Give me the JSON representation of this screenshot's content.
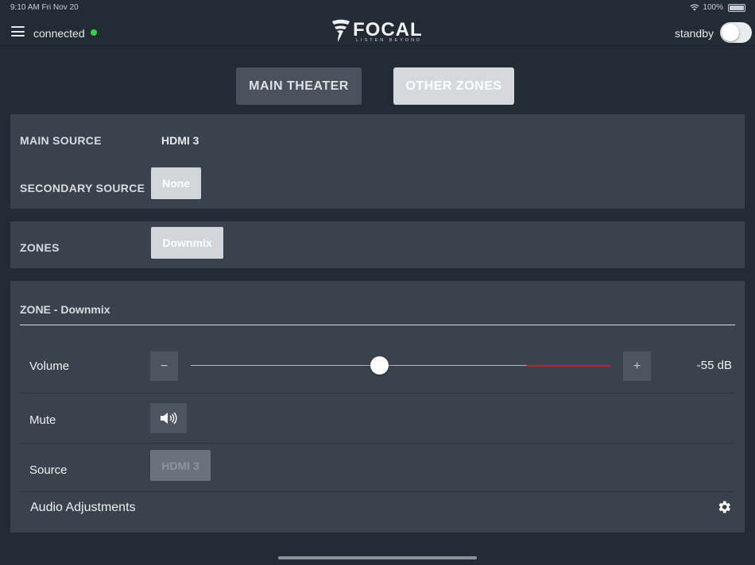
{
  "status_bar": {
    "time": "9:10 AM  Fri Nov 20",
    "battery": "100%"
  },
  "header": {
    "connection_status": "connected",
    "brand": "FOCAL",
    "tagline": "LISTEN BEYOND",
    "standby_label": "standby",
    "standby_on": false
  },
  "tabs": [
    {
      "label": "MAIN THEATER",
      "active": false
    },
    {
      "label": "OTHER ZONES",
      "active": true
    }
  ],
  "sources": {
    "main_label": "MAIN SOURCE",
    "main_value": "HDMI 3",
    "secondary_label": "SECONDARY SOURCE",
    "secondary_value": "None"
  },
  "zones": {
    "label": "ZONES",
    "value": "Downmix"
  },
  "zone": {
    "title": "ZONE - Downmix",
    "volume_label": "Volume",
    "volume_minus": "−",
    "volume_plus": "+",
    "volume_value": "-55 dB",
    "mute_label": "Mute",
    "source_label": "Source",
    "source_value": "HDMI 3",
    "audio_adjustments_label": "Audio Adjustments"
  },
  "colors": {
    "background": "#232b34",
    "panel": "#3a434d",
    "connected_dot": "#3ad14a",
    "volume_limit": "#b8242b"
  },
  "icons": [
    "menu-icon",
    "wifi-icon",
    "battery-icon",
    "focal-logo-icon",
    "speaker-icon",
    "gear-icon"
  ]
}
